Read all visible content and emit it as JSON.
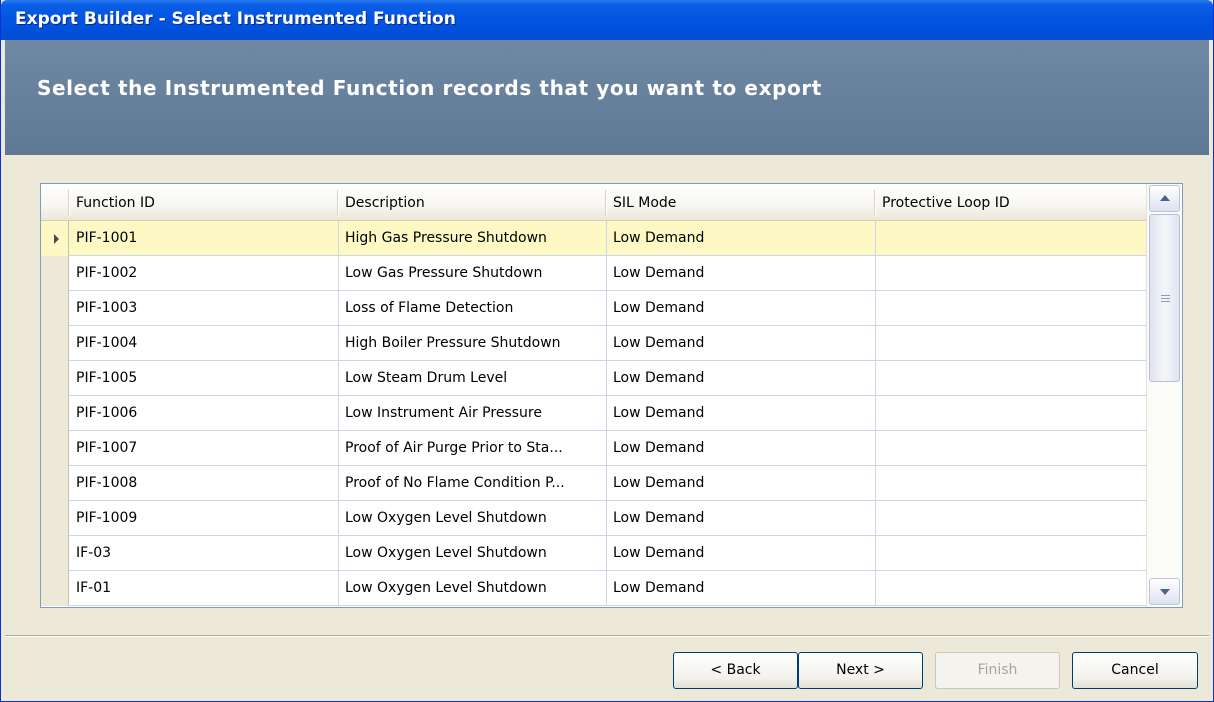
{
  "window": {
    "title": "Export Builder - Select Instrumented Function"
  },
  "banner": {
    "heading": "Select the Instrumented Function records that you want to export"
  },
  "grid": {
    "columns": [
      "Function ID",
      "Description",
      "SIL Mode",
      "Protective Loop ID"
    ],
    "rows": [
      {
        "function_id": "PIF-1001",
        "description": "High Gas Pressure Shutdown",
        "sil_mode": "Low Demand",
        "loop_id": "",
        "selected": true
      },
      {
        "function_id": "PIF-1002",
        "description": "Low Gas Pressure Shutdown",
        "sil_mode": "Low Demand",
        "loop_id": ""
      },
      {
        "function_id": "PIF-1003",
        "description": "Loss of Flame Detection",
        "sil_mode": "Low Demand",
        "loop_id": ""
      },
      {
        "function_id": "PIF-1004",
        "description": "High Boiler Pressure Shutdown",
        "sil_mode": "Low Demand",
        "loop_id": ""
      },
      {
        "function_id": "PIF-1005",
        "description": "Low Steam Drum Level",
        "sil_mode": "Low Demand",
        "loop_id": ""
      },
      {
        "function_id": "PIF-1006",
        "description": "Low Instrument Air Pressure",
        "sil_mode": "Low Demand",
        "loop_id": ""
      },
      {
        "function_id": "PIF-1007",
        "description": "Proof of Air Purge Prior to Sta...",
        "sil_mode": "Low Demand",
        "loop_id": ""
      },
      {
        "function_id": "PIF-1008",
        "description": "Proof of No Flame Condition P...",
        "sil_mode": "Low Demand",
        "loop_id": ""
      },
      {
        "function_id": "PIF-1009",
        "description": "Low Oxygen Level Shutdown",
        "sil_mode": "Low Demand",
        "loop_id": ""
      },
      {
        "function_id": "IF-03",
        "description": "Low Oxygen Level Shutdown",
        "sil_mode": "Low Demand",
        "loop_id": ""
      },
      {
        "function_id": "IF-01",
        "description": "Low Oxygen Level Shutdown",
        "sil_mode": "Low Demand",
        "loop_id": ""
      }
    ]
  },
  "buttons": {
    "back": "< Back",
    "next": "Next >",
    "finish": "Finish",
    "cancel": "Cancel"
  },
  "colors": {
    "titlebar": "#0255e0",
    "banner": "#6a83a0",
    "selected_row": "#fdf8c4"
  }
}
